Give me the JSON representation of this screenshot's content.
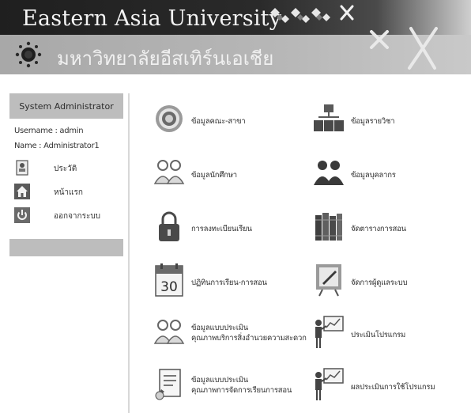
{
  "header": {
    "title": "Eastern Asia University",
    "subtitle": "มหาวิทยาลัยอีสเทิร์นเอเชีย"
  },
  "sidebar": {
    "title": "System Administrator",
    "username": "Username : admin",
    "name": "Name : Administrator1",
    "links": [
      {
        "label": "ประวัติ",
        "icon": "profile-icon"
      },
      {
        "label": "หน้าแรก",
        "icon": "home-icon"
      },
      {
        "label": "ออกจากระบบ",
        "icon": "power-icon"
      }
    ]
  },
  "menu": {
    "left": [
      {
        "label": "ข้อมูลคณะ-สาขา",
        "icon": "faculty-seal-icon"
      },
      {
        "label": "ข้อมูลนักศึกษา",
        "icon": "students-icon"
      },
      {
        "label": "การลงทะเบียนเรียน",
        "icon": "lock-icon"
      },
      {
        "label": "ปฏิทินการเรียน-การสอน",
        "icon": "calendar-icon",
        "day": "30"
      },
      {
        "label_line1": "ข้อมูลแบบประเมิน",
        "label_line2": "คุณภาพบริการสิ่งอำนวยความสะดวก",
        "icon": "survey-people-icon"
      },
      {
        "label_line1": "ข้อมูลแบบประเมิน",
        "label_line2": "คุณภาพการจัดการเรียนการสอน",
        "icon": "form-pen-icon"
      }
    ],
    "right": [
      {
        "label": "ข้อมูลรายวิชา",
        "icon": "org-chart-icon"
      },
      {
        "label": "ข้อมูลบุคลากร",
        "icon": "staff-icon"
      },
      {
        "label": "จัดตารางการสอน",
        "icon": "books-icon"
      },
      {
        "label": "จัดการผู้ดูแลระบบ",
        "icon": "admin-board-icon"
      },
      {
        "label": "ประเมินโปรแกรม",
        "icon": "presentation-icon"
      },
      {
        "label": "ผลประเมินการใช้โปรแกรม",
        "icon": "presentation-result-icon"
      }
    ]
  }
}
